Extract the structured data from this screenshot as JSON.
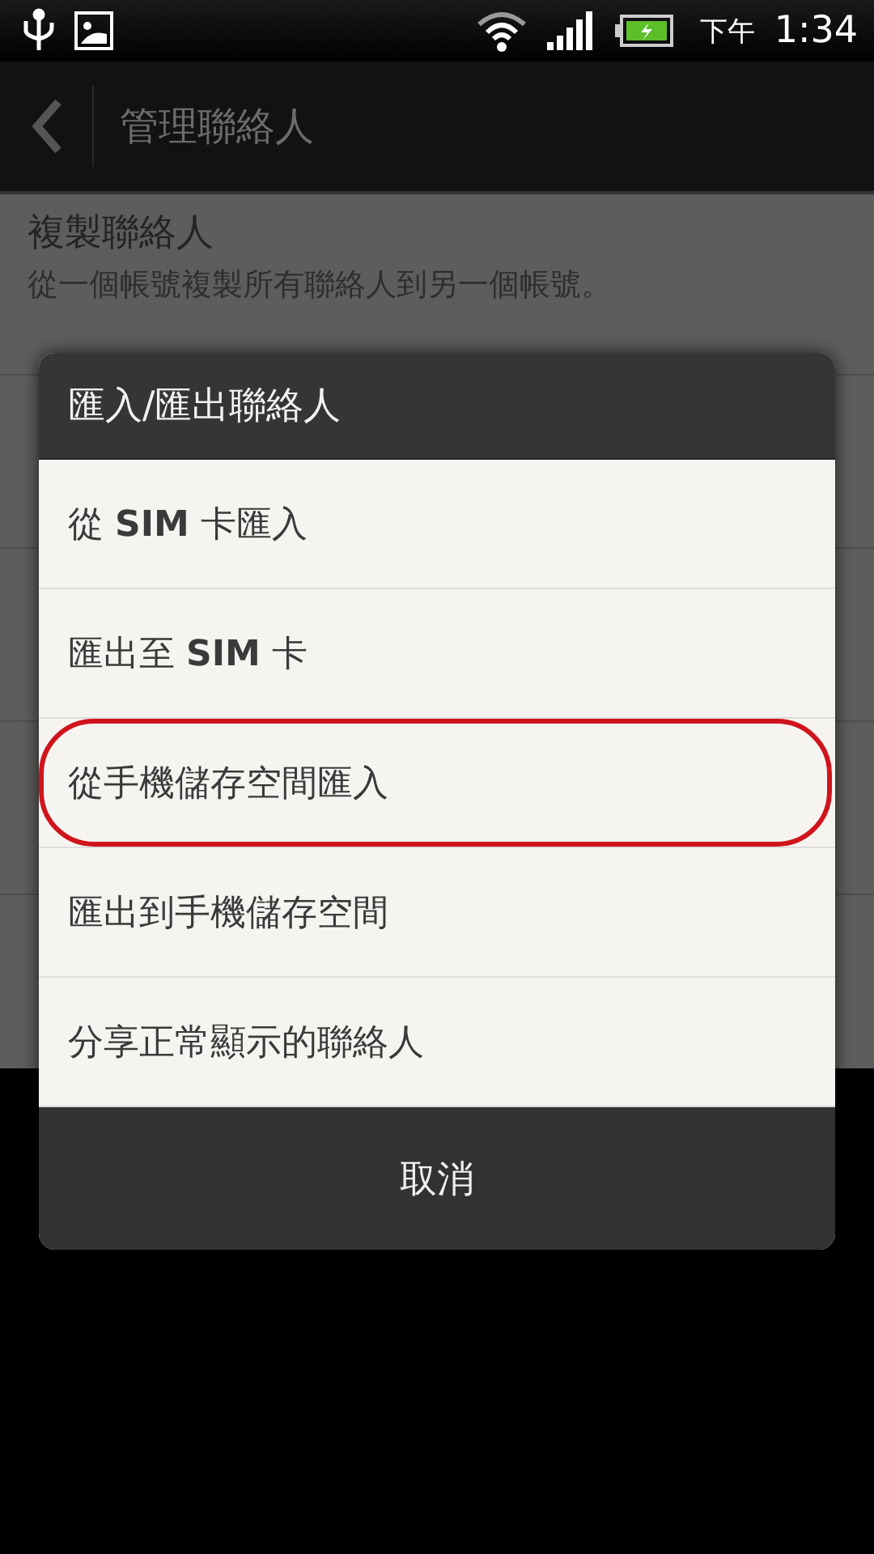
{
  "status_bar": {
    "period": "下午",
    "time": "1:34"
  },
  "action_bar": {
    "title": "管理聯絡人"
  },
  "settings": [
    {
      "title": "複製聯絡人",
      "subtitle": "從一個帳號複製所有聯絡人到另一個帳號。"
    }
  ],
  "dialog": {
    "title": "匯入/匯出聯絡人",
    "options": [
      {
        "label": "從 **SIM** 卡匯入",
        "circled": false
      },
      {
        "label": "匯出至 **SIM** 卡",
        "circled": false
      },
      {
        "label": "從手機儲存空間匯入",
        "circled": true
      },
      {
        "label": "匯出到手機儲存空間",
        "circled": false
      },
      {
        "label": "分享正常顯示的聯絡人",
        "circled": false
      }
    ],
    "cancel": "取消"
  }
}
